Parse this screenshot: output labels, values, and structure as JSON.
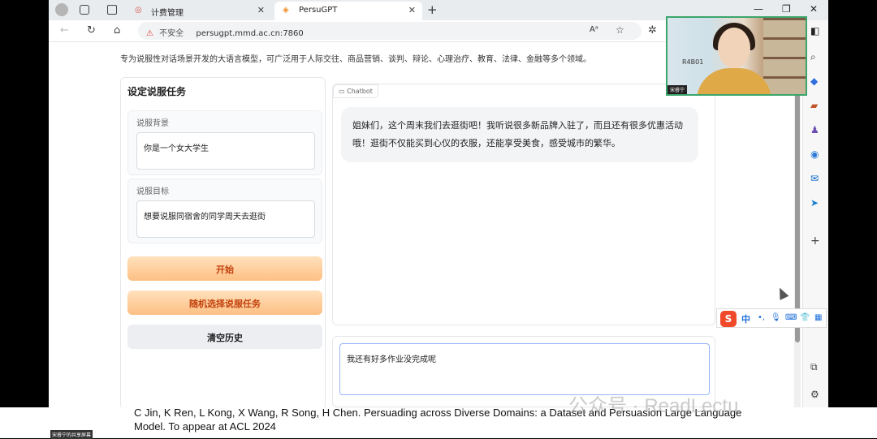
{
  "browser": {
    "tabs": [
      {
        "label": "计费管理",
        "active": false
      },
      {
        "label": "PersuGPT",
        "active": true
      }
    ],
    "address": {
      "insecure_label": "不安全",
      "url": "persugpt.mmd.ac.cn:7860"
    }
  },
  "page": {
    "description": "专为说服性对话场景开发的大语言模型，可广泛用于人际交往、商品营销、谈判、辩论、心理治疗、教育、法律、金融等多个领域。",
    "task_panel": {
      "title": "设定说服任务",
      "background_label": "说服背景",
      "background_value": "你是一个女大学生",
      "goal_label": "说服目标",
      "goal_value": "想要说服同宿舍的同学周天去逛街"
    },
    "buttons": {
      "start": "开始",
      "random": "随机选择说服任务",
      "clear": "清空历史"
    },
    "chatbot": {
      "label": "Chatbot",
      "message": "姐妹们，这个周末我们去逛街吧！我听说很多新品牌入驻了，而且还有很多优惠活动哦！逛街不仅能买到心仪的衣服，还能享受美食，感受城市的繁华。"
    },
    "input": {
      "value": "我还有好多作业没完成呢"
    }
  },
  "webcam": {
    "name_tag": "宋睿宁"
  },
  "ime": {
    "mode": "中"
  },
  "citation": "C Jin, K Ren, L Kong, X Wang, R Song, H Chen. Persuading across Diverse Domains: a Dataset and Persuasion Large Language Model. To appear at ACL 2024",
  "watermark": "公众号 · ReadLectu",
  "share_tag": "宋睿宁的共享屏幕",
  "colors": {
    "accent_orange": "#fdbf83",
    "button_text": "#c2410c",
    "focus_border": "#93b4f5"
  }
}
